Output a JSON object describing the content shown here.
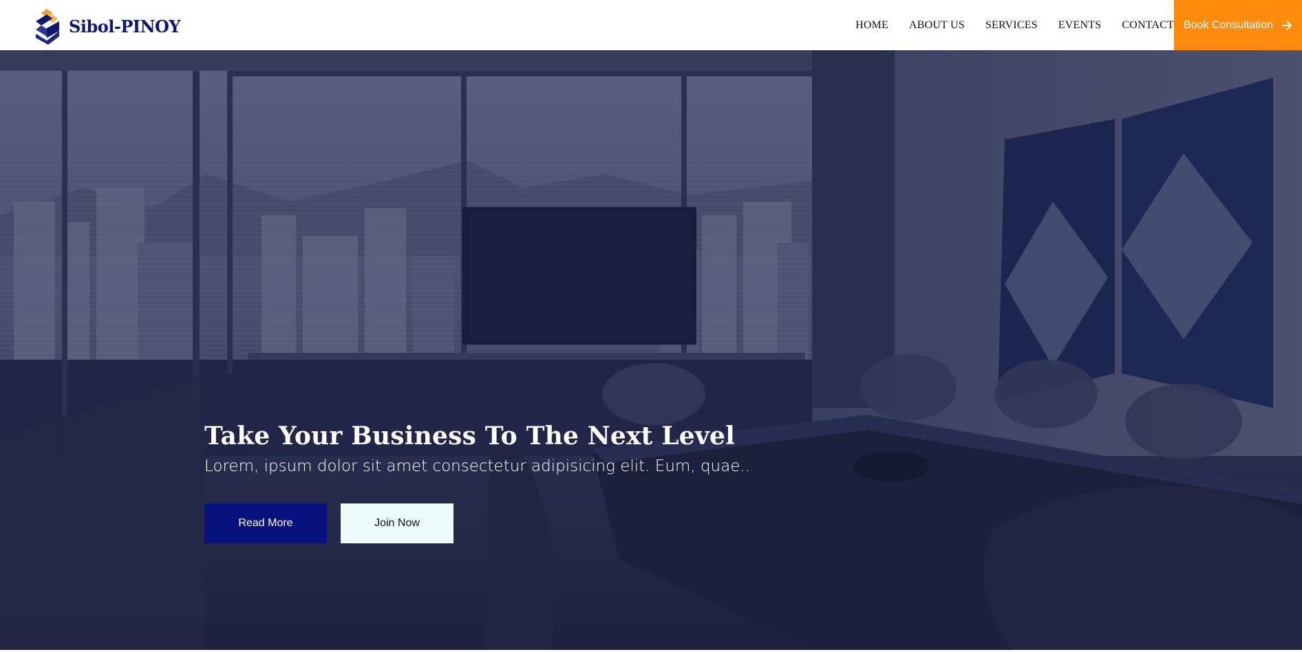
{
  "brand": {
    "name": "Sibol-PINOY",
    "logo_icon": "brand-logo-icon",
    "colors": {
      "navy": "#0d1670",
      "orange": "#f39a1f"
    }
  },
  "nav": {
    "links": [
      "HOME",
      "ABOUT US",
      "SERVICES",
      "EVENTS",
      "CONTACT"
    ],
    "cta_label": "Book Consultation",
    "cta_icon": "arrow-right-icon",
    "cta_color": "#ff8a0c"
  },
  "hero": {
    "title": "Take Your Business To The Next Level",
    "subtitle": "Lorem, ipsum dolor sit amet consectetur adipisicing elit. Eum, quae..",
    "buttons": {
      "primary": "Read More",
      "secondary": "Join Now"
    },
    "colors": {
      "primary_button": "#07117d",
      "secondary_button": "#eefbfb"
    }
  }
}
